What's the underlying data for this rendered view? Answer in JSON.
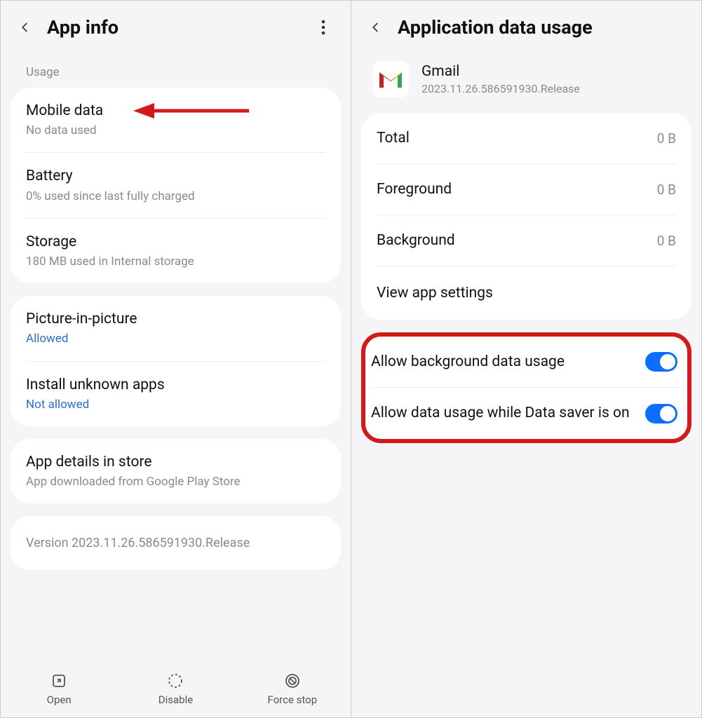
{
  "left": {
    "title": "App info",
    "section_usage": "Usage",
    "mobile_data": {
      "title": "Mobile data",
      "sub": "No data used"
    },
    "battery": {
      "title": "Battery",
      "sub": "0% used since last fully charged"
    },
    "storage": {
      "title": "Storage",
      "sub": "180 MB used in Internal storage"
    },
    "pip": {
      "title": "Picture-in-picture",
      "sub": "Allowed"
    },
    "unknown": {
      "title": "Install unknown apps",
      "sub": "Not allowed"
    },
    "details": {
      "title": "App details in store",
      "sub": "App downloaded from Google Play Store"
    },
    "version": "Version 2023.11.26.586591930.Release",
    "open": "Open",
    "disable": "Disable",
    "force_stop": "Force stop"
  },
  "right": {
    "title": "Application data usage",
    "app_name": "Gmail",
    "app_version": "2023.11.26.586591930.Release",
    "total_label": "Total",
    "total_value": "0 B",
    "fg_label": "Foreground",
    "fg_value": "0 B",
    "bg_label": "Background",
    "bg_value": "0 B",
    "view_settings": "View app settings",
    "allow_bg": "Allow background data usage",
    "allow_saver": "Allow data usage while Data saver is on"
  }
}
